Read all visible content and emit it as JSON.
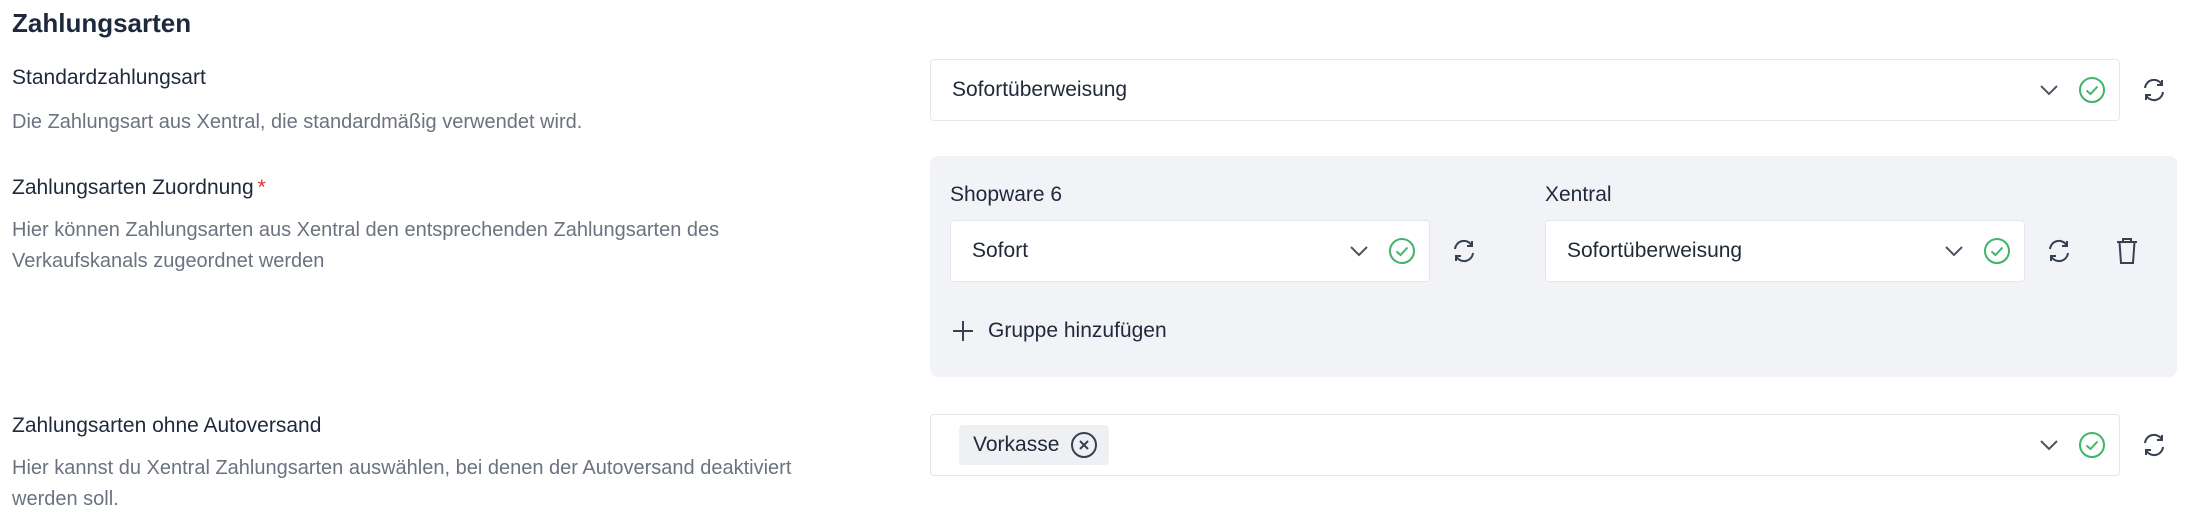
{
  "section": {
    "title": "Zahlungsarten"
  },
  "default_payment": {
    "label": "Standardzahlungsart",
    "description": "Die Zahlungsart aus Xentral, die standardmäßig verwendet wird.",
    "value": "Sofortüberweisung"
  },
  "mapping": {
    "label": "Zahlungsarten Zuordnung",
    "required_mark": "*",
    "description_line1": "Hier können Zahlungsarten aus Xentral den entsprechenden Zahlungsarten des",
    "description_line2": "Verkaufskanals zugeordnet werden",
    "col_shopware": "Shopware 6",
    "col_xentral": "Xentral",
    "shopware_value": "Sofort",
    "xentral_value": "Sofortüberweisung",
    "add_group_label": "Gruppe hinzufügen"
  },
  "no_autoship": {
    "label": "Zahlungsarten ohne Autoversand",
    "description_line1": "Hier kannst du Xentral Zahlungsarten auswählen, bei denen der Autoversand deaktiviert",
    "description_line2": "werden soll.",
    "chips": [
      "Vorkasse"
    ]
  },
  "colors": {
    "success": "#3fb46a",
    "danger": "#e03131",
    "panel": "#f1f3f7"
  }
}
